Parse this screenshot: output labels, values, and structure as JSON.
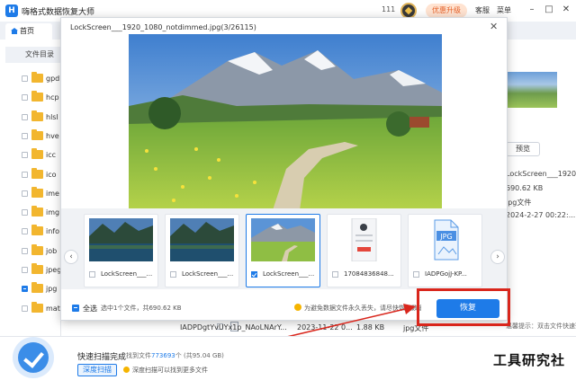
{
  "app": {
    "title": "嗨格式数据恢复大师",
    "version": "111",
    "upgrade": "优惠升级",
    "service": "客服",
    "menu": "菜单"
  },
  "tabs": {
    "home": "首页"
  },
  "sidebar": {
    "header": "文件目录",
    "folders": [
      "gpd",
      "hcp",
      "hlsl",
      "hve",
      "icc",
      "ico",
      "ime",
      "img",
      "info",
      "job",
      "jpeg",
      "jpg",
      "mat"
    ]
  },
  "right_panel": {
    "preview_button": "预览",
    "file_name": "LockScreen___1920_1...",
    "size": "690.62 KB",
    "type": "jpg文件",
    "date": "2024-2-27 00:22:...",
    "hint": "温馨提示：双击文件快速预览"
  },
  "background_row": {
    "name": "IADPDgtYvUYx1p_NAoLNArY...",
    "date": "2023-11-22 0...",
    "size": "1.88 KB",
    "type": "jpg文件"
  },
  "dialog": {
    "title": "LockScreen___1920_1080_notdimmed.jpg(3/26115)",
    "thumbnails": [
      {
        "name": "LockScreen___...",
        "checked": false,
        "kind": "lake"
      },
      {
        "name": "LockScreen___...",
        "checked": false,
        "kind": "lake"
      },
      {
        "name": "LockScreen___...",
        "checked": true,
        "kind": "meadow"
      },
      {
        "name": "17084836848...",
        "checked": false,
        "kind": "phone"
      },
      {
        "name": "IADPGojJ-KP...",
        "checked": false,
        "kind": "jpg-icon"
      }
    ],
    "jpg_icon_label": "JPG",
    "select_all": "全选",
    "selection_info": "选中1个文件，共690.62 KB",
    "warning": "为避免数据文件永久丢失，请尽快恢复数据",
    "recover_button": "恢复"
  },
  "bottom": {
    "scan_done": "快速扫描完成",
    "found_prefix": "找到文件",
    "found_count": "773693",
    "found_suffix": "个 (共95.04 GB)",
    "deep_scan_button": "深度扫描",
    "deep_scan_hint": "深度扫描可以找到更多文件",
    "watermark": "工具研究社"
  },
  "colors": {
    "accent": "#1e7be8",
    "highlight": "#d9261c",
    "folder": "#f2b62f",
    "upgrade_text": "#e5622a"
  }
}
